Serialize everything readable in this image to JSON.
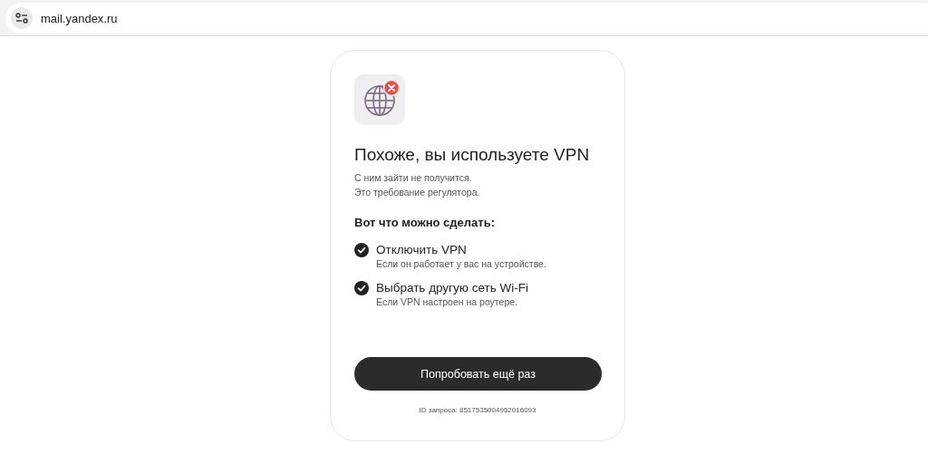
{
  "address_bar": {
    "url": "mail.yandex.ru"
  },
  "card": {
    "title": "Похоже, вы используете VPN",
    "description": [
      "С ним зайти не получится.",
      "Это требование регулятора."
    ],
    "options_heading": "Вот что можно сделать:",
    "options": [
      {
        "title": "Отключить VPN",
        "hint": "Если он работает у вас на устройстве."
      },
      {
        "title": "Выбрать другую сеть Wi-Fi",
        "hint": "Если VPN настроен на роутере."
      }
    ],
    "button": "Попробовать ещё раз",
    "request_id": "ID запроса: 8517535004952016093"
  }
}
